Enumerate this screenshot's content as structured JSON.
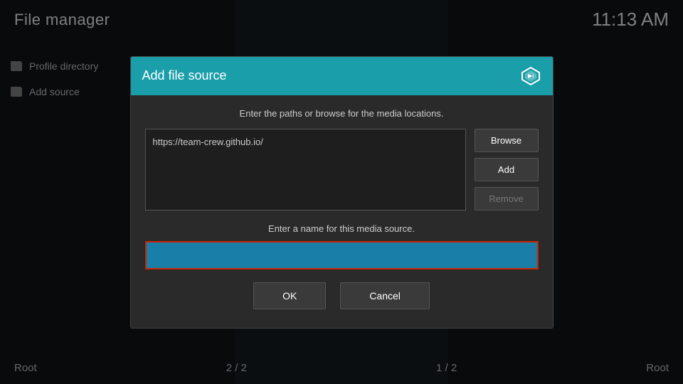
{
  "app": {
    "title": "File manager",
    "time": "11:13 AM"
  },
  "sidebar": {
    "items": [
      {
        "id": "profile-directory",
        "label": "Profile directory"
      },
      {
        "id": "add-source",
        "label": "Add source"
      }
    ]
  },
  "bottom": {
    "left_label": "Root",
    "center_left": "2 / 2",
    "center_right": "1 / 2",
    "right_label": "Root"
  },
  "dialog": {
    "title": "Add file source",
    "subtitle": "Enter the paths or browse for the media locations.",
    "url_value": "https://team-crew.github.io/",
    "browse_label": "Browse",
    "add_label": "Add",
    "remove_label": "Remove",
    "name_label": "Enter a name for this media source.",
    "name_value": "",
    "name_placeholder": "",
    "ok_label": "OK",
    "cancel_label": "Cancel"
  }
}
